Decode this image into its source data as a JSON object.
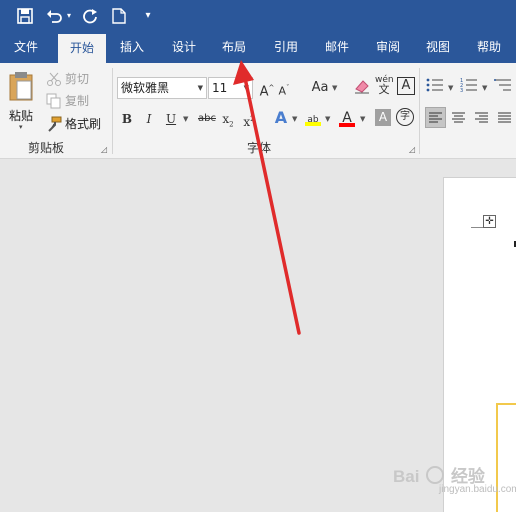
{
  "quick_access": {
    "save_icon": "save-icon",
    "undo_icon": "undo-icon",
    "redo_icon": "redo-icon",
    "new_doc_icon": "new-document-icon",
    "customize_icon": "customize-toolbar-icon"
  },
  "tabs": [
    {
      "label": "文件"
    },
    {
      "label": "开始",
      "active": true
    },
    {
      "label": "插入"
    },
    {
      "label": "设计"
    },
    {
      "label": "布局"
    },
    {
      "label": "引用"
    },
    {
      "label": "邮件"
    },
    {
      "label": "审阅"
    },
    {
      "label": "视图"
    },
    {
      "label": "帮助"
    }
  ],
  "clipboard": {
    "paste_label": "粘贴",
    "cut_label": "剪切",
    "copy_label": "复制",
    "format_painter_label": "格式刷",
    "group_label": "剪贴板"
  },
  "font": {
    "font_name": "微软雅黑",
    "font_size": "11",
    "change_case_label": "Aa",
    "phonetic_label": "wén",
    "phonetic_sub": "文",
    "border_char": "A",
    "enclose_char": "字",
    "bold": "B",
    "italic": "I",
    "underline": "U",
    "strikethrough": "abc",
    "subscript": "x",
    "superscript": "x",
    "highlight_label": "ab",
    "font_color_label": "A",
    "shade_label": "A",
    "group_label": "字体"
  },
  "colors": {
    "title_bar": "#2b579a",
    "ribbon_bg": "#f3f3f3",
    "canvas_bg": "#e6e6e6",
    "arrow": "#e02b2b",
    "highlight_yellow": "#ffff00",
    "font_color_red": "#ff0000"
  },
  "watermark": {
    "text": "Bai",
    "suffix": "经验",
    "sub": "jingyan.baidu.com"
  }
}
